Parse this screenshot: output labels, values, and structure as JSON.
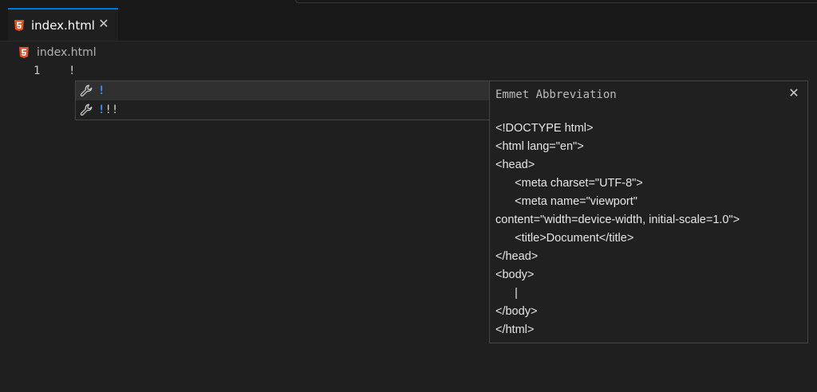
{
  "tab": {
    "label": "index.html",
    "close_glyph": "✕",
    "icon": "html5-icon"
  },
  "breadcrumb": {
    "label": "index.html",
    "icon": "html5-icon"
  },
  "editor": {
    "line_number": "1",
    "line_text": "!"
  },
  "suggestions": [
    {
      "icon": "wrench-icon",
      "highlight": "!",
      "rest": "",
      "selected": true
    },
    {
      "icon": "wrench-icon",
      "highlight": "!",
      "rest": "!!",
      "selected": false
    }
  ],
  "details": {
    "title": "Emmet Abbreviation",
    "close_glyph": "✕",
    "lines": [
      "<!DOCTYPE html>",
      "<html lang=\"en\">",
      "<head>",
      "      <meta charset=\"UTF-8\">",
      "      <meta name=\"viewport\"",
      "content=\"width=device-width, initial-scale=1.0\">",
      "      <title>Document</title>",
      "</head>",
      "<body>",
      "      |",
      "</body>",
      "</html>"
    ]
  },
  "colors": {
    "accent": "#0078d4",
    "html_icon": "#e44d26",
    "suggest_match": "#3794ff"
  }
}
